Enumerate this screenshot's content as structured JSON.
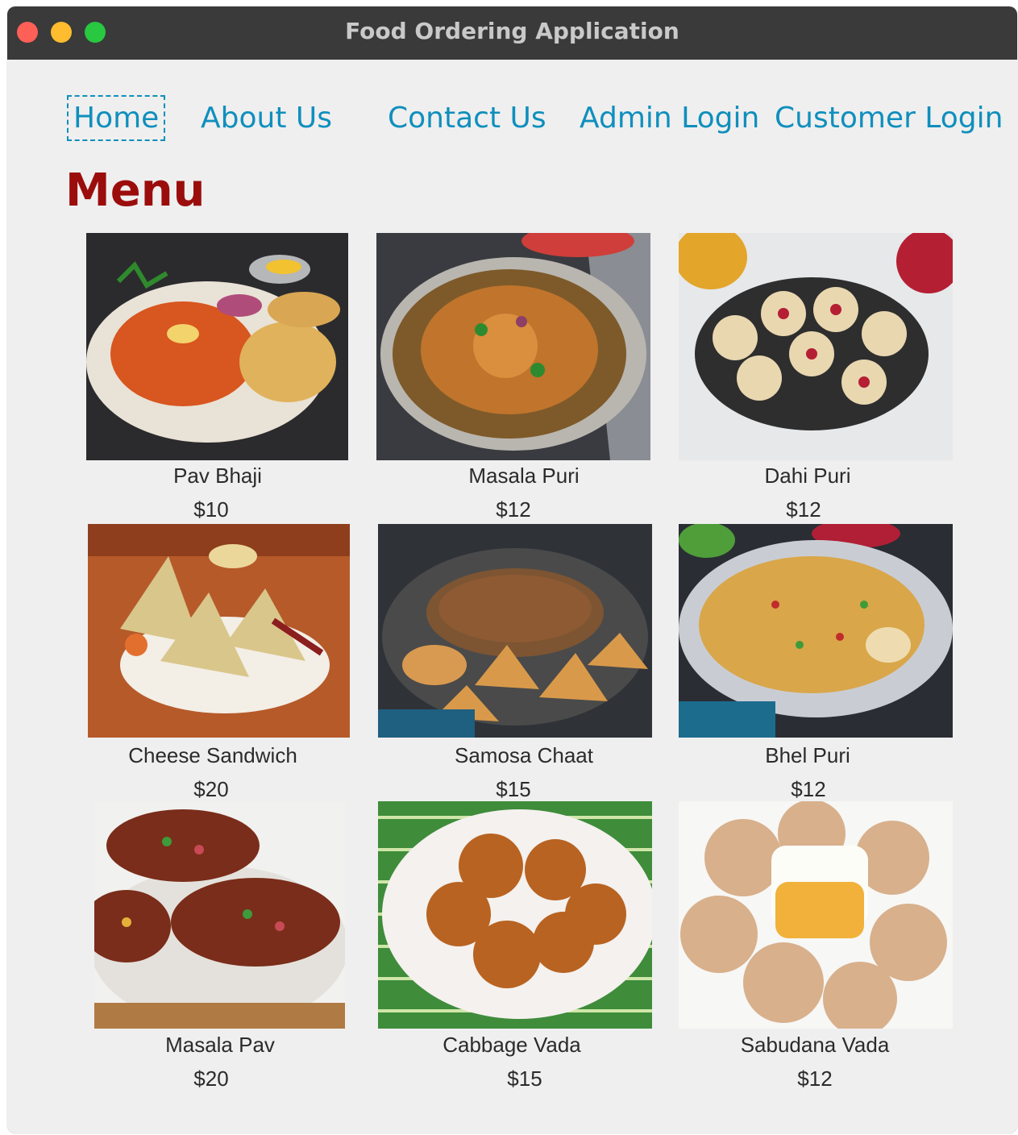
{
  "window": {
    "title": "Food Ordering Application"
  },
  "nav": {
    "home": "Home",
    "about": "About Us",
    "contact": "Contact Us",
    "admin": "Admin Login",
    "customer": "Customer Login"
  },
  "menu": {
    "heading": "Menu",
    "items": [
      {
        "name": "Pav Bhaji",
        "price": "$10",
        "photo": "pav-bhaji-photo"
      },
      {
        "name": "Masala Puri",
        "price": "$12",
        "photo": "masala-puri-photo"
      },
      {
        "name": "Dahi Puri",
        "price": "$12",
        "photo": "dahi-puri-photo"
      },
      {
        "name": "Cheese Sandwich",
        "price": "$20",
        "photo": "cheese-sandwich-photo"
      },
      {
        "name": "Samosa Chaat",
        "price": "$15",
        "photo": "samosa-chaat-photo"
      },
      {
        "name": "Bhel Puri",
        "price": "$12",
        "photo": "bhel-puri-photo"
      },
      {
        "name": "Masala Pav",
        "price": "$20",
        "photo": "masala-pav-photo"
      },
      {
        "name": "Cabbage Vada",
        "price": "$15",
        "photo": "cabbage-vada-photo"
      },
      {
        "name": "Sabudana Vada",
        "price": "$12",
        "photo": "sabudana-vada-photo"
      }
    ]
  },
  "colors": {
    "nav": "#0f8fbd",
    "heading": "#9b0d0d",
    "titlebar": "#3a3a3a",
    "background": "#efefef"
  }
}
